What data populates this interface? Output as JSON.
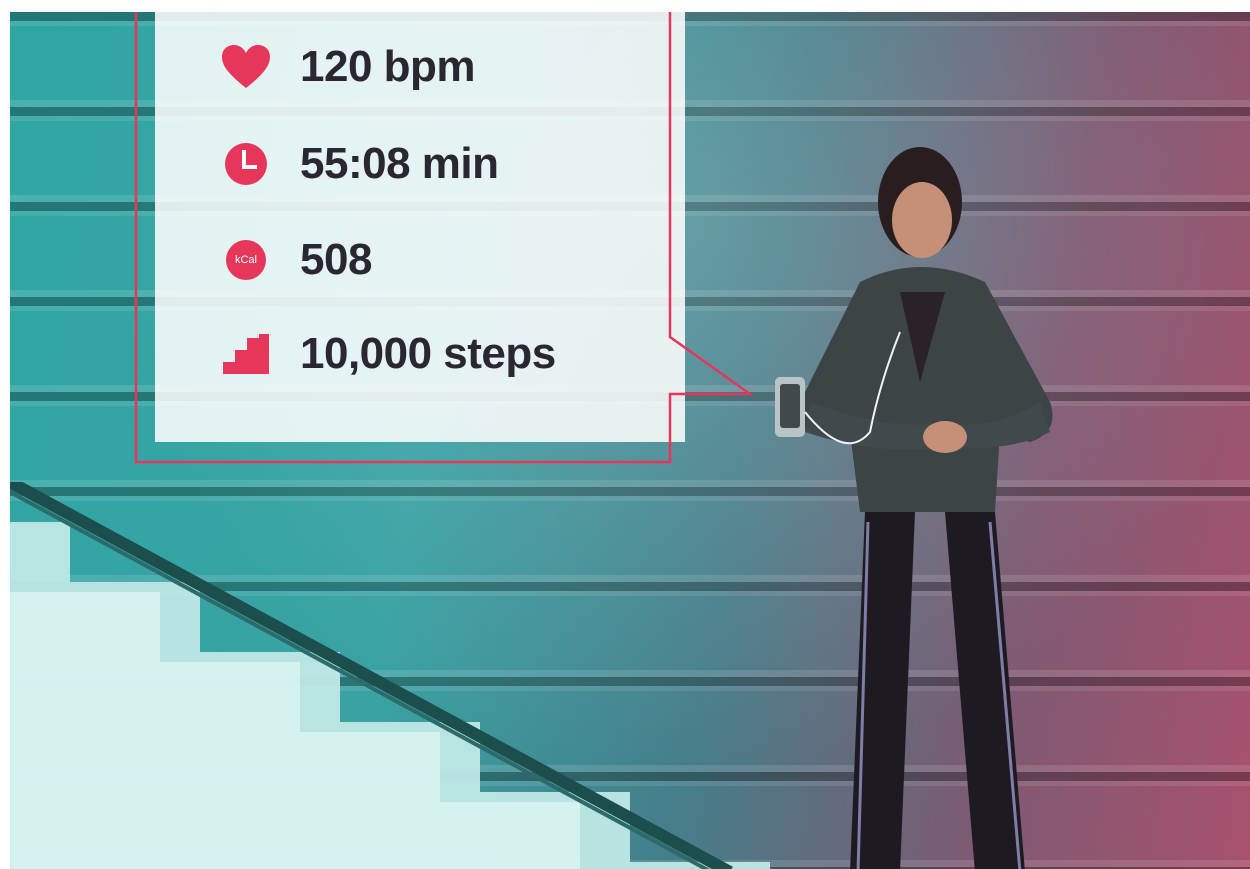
{
  "stats": [
    {
      "icon": "heart-icon",
      "value": "120 bpm"
    },
    {
      "icon": "clock-icon",
      "value": "55:08 min"
    },
    {
      "icon": "kcal-icon",
      "value": "508",
      "badge_text": "kCal"
    },
    {
      "icon": "stairs-icon",
      "value": "10,000 steps"
    }
  ],
  "colors": {
    "accent": "#e6365a",
    "text": "#2a2730",
    "wall_teal": "#2fa6a4",
    "wall_magenta": "#a8516d"
  }
}
